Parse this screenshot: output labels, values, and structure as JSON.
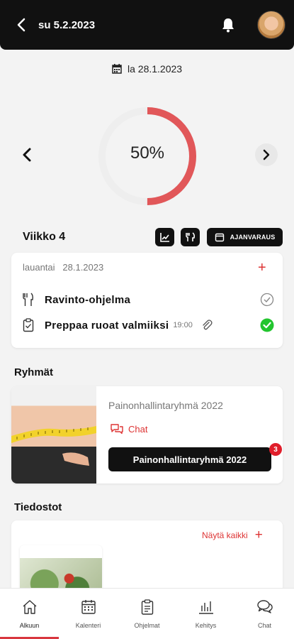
{
  "header": {
    "title": "su 5.2.2023"
  },
  "date_bar": {
    "date": "la 28.1.2023"
  },
  "progress": {
    "percent_label": "50%",
    "percent": 50,
    "color": "#e15759",
    "track_color": "#eeeeee"
  },
  "week": {
    "label": "Viikko 4",
    "booking_label": "AJANVARAUS"
  },
  "day_card": {
    "weekday": "lauantai",
    "date": "28.1.2023",
    "tasks": [
      {
        "name": "Ravinto-ohjelma",
        "time": "",
        "done": false
      },
      {
        "name": "Preppaa ruoat valmiiksi",
        "time": "19:00",
        "done": true
      }
    ]
  },
  "groups": {
    "title": "Ryhmät",
    "card": {
      "name": "Painonhallintaryhmä 2022",
      "chat_label": "Chat",
      "button_label": "Painonhallintaryhmä 2022",
      "badge": "3"
    }
  },
  "files": {
    "title": "Tiedostot",
    "show_all": "Näytä kaikki"
  },
  "tabs": [
    {
      "label": "Alkuun",
      "icon": "home-icon",
      "active": true
    },
    {
      "label": "Kalenteri",
      "icon": "calendar-icon",
      "active": false
    },
    {
      "label": "Ohjelmat",
      "icon": "clipboard-icon",
      "active": false
    },
    {
      "label": "Kehitys",
      "icon": "chart-icon",
      "active": false
    },
    {
      "label": "Chat",
      "icon": "chat-icon",
      "active": false
    }
  ],
  "colors": {
    "accent": "#d33333",
    "dark": "#111111",
    "success": "#22c52e"
  }
}
